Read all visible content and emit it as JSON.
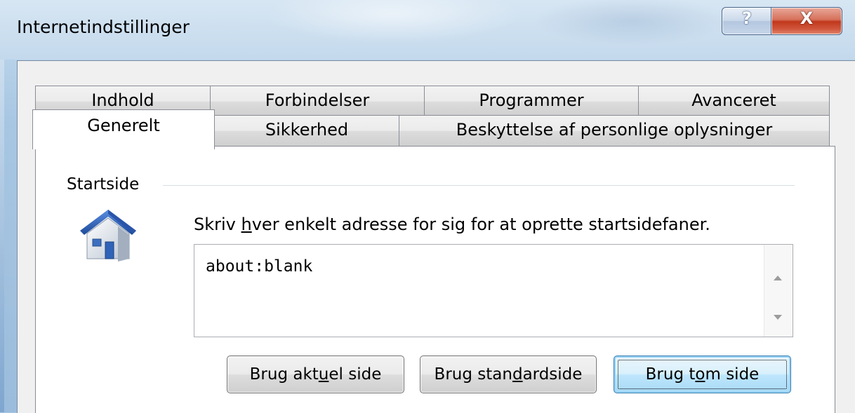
{
  "window": {
    "title": "Internetindstillinger",
    "help_glyph": "?",
    "close_glyph": "X"
  },
  "tabs_row1": [
    {
      "label": "Indhold"
    },
    {
      "label": "Forbindelser"
    },
    {
      "label": "Programmer"
    },
    {
      "label": "Avanceret"
    }
  ],
  "tabs_row2": [
    {
      "label": "Generelt",
      "active": true
    },
    {
      "label": "Sikkerhed"
    },
    {
      "label": "Beskyttelse af personlige oplysninger"
    }
  ],
  "homepage": {
    "group_label": "Startside",
    "icon": "house-icon",
    "hint_pre": "Skriv ",
    "hint_underlined": "h",
    "hint_post": "ver enkelt adresse for sig for at oprette startsidefaner.",
    "address_value": "about:blank",
    "buttons": {
      "current_pre": "Brug akt",
      "current_u": "u",
      "current_post": "el side",
      "default_pre": "Brug stan",
      "default_u": "d",
      "default_post": "ardside",
      "blank_pre": "Brug t",
      "blank_u": "o",
      "blank_post": "m side"
    }
  },
  "colors": {
    "house_roof": "#2f63b8",
    "house_wall": "#e8edf3",
    "default_button_border": "#3c7fb1"
  }
}
